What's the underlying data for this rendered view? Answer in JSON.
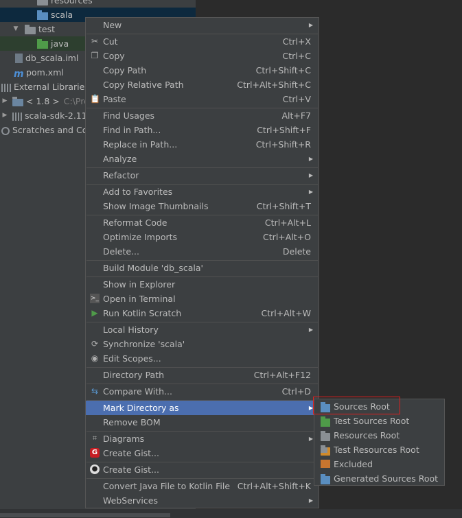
{
  "tree": {
    "items": [
      {
        "label": "resources"
      },
      {
        "label": "scala"
      },
      {
        "label": "test"
      },
      {
        "label": "java"
      },
      {
        "label": "db_scala.iml"
      },
      {
        "label": "pom.xml"
      },
      {
        "label": "External Libraries"
      },
      {
        "label": "< 1.8 >",
        "extra": "C:\\Prog"
      },
      {
        "label": "scala-sdk-2.11."
      },
      {
        "label": "Scratches and Cor"
      }
    ]
  },
  "menu": {
    "items": [
      {
        "label": "New",
        "shortcut": "",
        "submenu": true
      },
      {
        "label": "Cut",
        "shortcut": "Ctrl+X",
        "icon": "cut-icon"
      },
      {
        "label": "Copy",
        "shortcut": "Ctrl+C",
        "icon": "copy-icon"
      },
      {
        "label": "Copy Path",
        "shortcut": "Ctrl+Shift+C"
      },
      {
        "label": "Copy Relative Path",
        "shortcut": "Ctrl+Alt+Shift+C"
      },
      {
        "label": "Paste",
        "shortcut": "Ctrl+V",
        "icon": "paste-icon"
      },
      {
        "label": "Find Usages",
        "shortcut": "Alt+F7"
      },
      {
        "label": "Find in Path...",
        "shortcut": "Ctrl+Shift+F"
      },
      {
        "label": "Replace in Path...",
        "shortcut": "Ctrl+Shift+R"
      },
      {
        "label": "Analyze",
        "shortcut": "",
        "submenu": true
      },
      {
        "label": "Refactor",
        "shortcut": "",
        "submenu": true
      },
      {
        "label": "Add to Favorites",
        "shortcut": "",
        "submenu": true
      },
      {
        "label": "Show Image Thumbnails",
        "shortcut": "Ctrl+Shift+T"
      },
      {
        "label": "Reformat Code",
        "shortcut": "Ctrl+Alt+L"
      },
      {
        "label": "Optimize Imports",
        "shortcut": "Ctrl+Alt+O"
      },
      {
        "label": "Delete...",
        "shortcut": "Delete"
      },
      {
        "label": "Build Module 'db_scala'",
        "shortcut": ""
      },
      {
        "label": "Show in Explorer",
        "shortcut": ""
      },
      {
        "label": "Open in Terminal",
        "shortcut": "",
        "icon": "terminal-icon"
      },
      {
        "label": "Run Kotlin Scratch",
        "shortcut": "Ctrl+Alt+W",
        "icon": "run-icon"
      },
      {
        "label": "Local History",
        "shortcut": "",
        "submenu": true
      },
      {
        "label": "Synchronize 'scala'",
        "shortcut": "",
        "icon": "sync-icon"
      },
      {
        "label": "Edit Scopes...",
        "shortcut": "",
        "icon": "scope-icon"
      },
      {
        "label": "Directory Path",
        "shortcut": "Ctrl+Alt+F12"
      },
      {
        "label": "Compare With...",
        "shortcut": "Ctrl+D",
        "icon": "compare-icon"
      },
      {
        "label": "Mark Directory as",
        "shortcut": "",
        "submenu": true,
        "highlighted": true
      },
      {
        "label": "Remove BOM",
        "shortcut": ""
      },
      {
        "label": "Diagrams",
        "shortcut": "",
        "submenu": true,
        "icon": "diagram-icon"
      },
      {
        "label": "Create Gist...",
        "shortcut": "",
        "icon": "gist-icon"
      },
      {
        "label": "Create Gist...",
        "shortcut": "",
        "icon": "github-icon"
      },
      {
        "label": "Convert Java File to Kotlin File",
        "shortcut": "Ctrl+Alt+Shift+K"
      },
      {
        "label": "WebServices",
        "shortcut": "",
        "submenu": true
      }
    ]
  },
  "submenu": {
    "items": [
      {
        "label": "Sources Root",
        "color": "#5a8ec0"
      },
      {
        "label": "Test Sources Root",
        "color": "#4f9b49"
      },
      {
        "label": "Resources Root",
        "color": "#8a8f94"
      },
      {
        "label": "Test Resources Root",
        "color": "#8a8f94"
      },
      {
        "label": "Excluded",
        "color": "#c8752f"
      },
      {
        "label": "Generated Sources Root",
        "color": "#5a8ec0"
      }
    ]
  },
  "colors": {
    "highlight": "#4b6eaf",
    "annotation_box": "#e02020"
  }
}
